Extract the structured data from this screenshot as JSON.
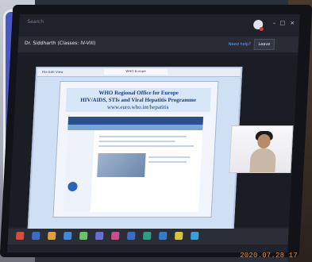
{
  "app": {
    "window_search": "Search"
  },
  "call": {
    "title": "Dr. Siddharth (Classes: IV-VIII)",
    "help_link": "Need help?",
    "leave_label": "Leave"
  },
  "shared_page": {
    "browser_tab": "WHO Europe",
    "menu": "File Edit View",
    "heading_line1": "WHO Regional Office for Europe",
    "heading_line2": "HIV/AIDS, STIs and Viral Hepatitis Programme",
    "heading_url": "www.euro.who.int/hepatitis"
  },
  "timestamp": "2020.07.28 17"
}
